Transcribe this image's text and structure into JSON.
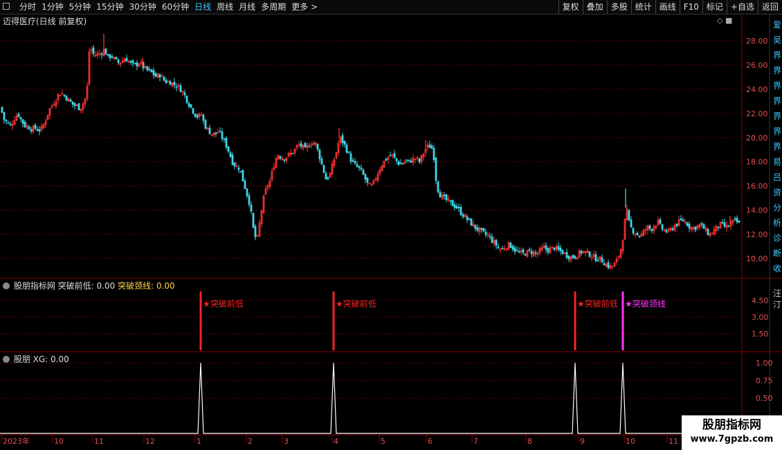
{
  "toolbar": {
    "tabs": [
      "分时",
      "1分钟",
      "5分钟",
      "15分钟",
      "30分钟",
      "60分钟",
      "日线",
      "周线",
      "月线",
      "多周期",
      "更多 >"
    ],
    "active_index": 6,
    "right_tools": [
      "复权",
      "叠加",
      "多股",
      "统计",
      "画线",
      "F10",
      "标记",
      "+自选",
      "返回"
    ]
  },
  "main": {
    "title": "迈得医疗(日线 前复权)",
    "right_side_chars": "爱吴界界界界界界界易吕资分析诊断收",
    "icons": "◇ ■"
  },
  "indicator1": {
    "name": "股朋指标网",
    "s1_label": "突破前低:",
    "s1_value": "0.00",
    "s2_label": "突破颈线:",
    "s2_value": "0.00",
    "right_chars": "汪汀"
  },
  "indicator2": {
    "name": "股朋",
    "xg_label": "XG:",
    "xg_value": "0.00"
  },
  "watermark": {
    "line1": "股朋指标网",
    "line2": "www.7gpzb.com"
  },
  "colors": {
    "up": "#ff3333",
    "down": "#43d6e6",
    "signal_low": "#ff2222",
    "signal_neck": "#ff33ff",
    "grid": "#6b0000",
    "active_tab": "#3cc8ff"
  },
  "chart_data": [
    {
      "type": "candlestick",
      "title": "迈得医疗(日线 前复权)",
      "y_ticks": [
        10.0,
        12.0,
        14.0,
        16.0,
        18.0,
        20.0,
        22.0,
        24.0,
        26.0,
        28.0
      ],
      "ylim": [
        8.6,
        29.2
      ],
      "x_labels": [
        "2023年",
        "10",
        "11",
        "12",
        "1",
        "2",
        "3",
        "4",
        "5",
        "6",
        "7",
        "8",
        "9",
        "10",
        "11"
      ],
      "close_path": [
        [
          0,
          22.5
        ],
        [
          5,
          21.5
        ],
        [
          10,
          21.2
        ],
        [
          15,
          21.0
        ],
        [
          20,
          21.6
        ],
        [
          25,
          22.0
        ],
        [
          30,
          21.4
        ],
        [
          35,
          21.0
        ],
        [
          40,
          20.9
        ],
        [
          45,
          20.7
        ],
        [
          50,
          20.8
        ],
        [
          55,
          20.6
        ],
        [
          60,
          20.8
        ],
        [
          63,
          21.2
        ],
        [
          67,
          21.8
        ],
        [
          70,
          22.3
        ],
        [
          75,
          22.7
        ],
        [
          80,
          23.2
        ],
        [
          83,
          23.5
        ],
        [
          87,
          23.7
        ],
        [
          90,
          23.6
        ],
        [
          95,
          23.3
        ],
        [
          100,
          23.0
        ],
        [
          105,
          22.7
        ],
        [
          110,
          22.6
        ],
        [
          115,
          22.4
        ],
        [
          118,
          22.7
        ],
        [
          122,
          23.2
        ],
        [
          125,
          24.2
        ],
        [
          127,
          27.0
        ],
        [
          130,
          27.4
        ],
        [
          135,
          26.8
        ],
        [
          140,
          26.9
        ],
        [
          145,
          27.0
        ],
        [
          150,
          27.3
        ],
        [
          155,
          26.6
        ],
        [
          160,
          26.8
        ],
        [
          165,
          26.4
        ],
        [
          170,
          26.2
        ],
        [
          175,
          26.3
        ],
        [
          180,
          26.6
        ],
        [
          185,
          26.3
        ],
        [
          190,
          26.0
        ],
        [
          195,
          26.0
        ],
        [
          200,
          26.2
        ],
        [
          205,
          25.9
        ],
        [
          210,
          25.6
        ],
        [
          215,
          25.5
        ],
        [
          220,
          25.3
        ],
        [
          225,
          25.0
        ],
        [
          230,
          25.2
        ],
        [
          235,
          24.8
        ],
        [
          240,
          24.6
        ],
        [
          245,
          24.6
        ],
        [
          250,
          24.4
        ],
        [
          255,
          24.3
        ],
        [
          260,
          24.0
        ],
        [
          265,
          23.6
        ],
        [
          270,
          23.0
        ],
        [
          275,
          22.5
        ],
        [
          280,
          22.0
        ],
        [
          285,
          21.7
        ],
        [
          290,
          21.9
        ],
        [
          295,
          21.0
        ],
        [
          300,
          20.6
        ],
        [
          305,
          20.3
        ],
        [
          310,
          20.3
        ],
        [
          315,
          20.5
        ],
        [
          320,
          20.0
        ],
        [
          325,
          19.5
        ],
        [
          330,
          18.8
        ],
        [
          335,
          18.0
        ],
        [
          340,
          17.6
        ],
        [
          345,
          17.5
        ],
        [
          350,
          16.5
        ],
        [
          355,
          15.5
        ],
        [
          360,
          14.5
        ],
        [
          365,
          12.5
        ],
        [
          370,
          11.3
        ],
        [
          373,
          12.5
        ],
        [
          377,
          14.0
        ],
        [
          381,
          15.3
        ],
        [
          385,
          16.0
        ],
        [
          389,
          16.4
        ],
        [
          393,
          17.3
        ],
        [
          397,
          18.2
        ],
        [
          401,
          18.6
        ],
        [
          405,
          18.4
        ],
        [
          410,
          18.3
        ],
        [
          415,
          18.5
        ],
        [
          420,
          18.7
        ],
        [
          425,
          19.0
        ],
        [
          430,
          19.4
        ],
        [
          435,
          19.3
        ],
        [
          440,
          19.0
        ],
        [
          445,
          19.4
        ],
        [
          450,
          19.6
        ],
        [
          455,
          19.5
        ],
        [
          460,
          18.6
        ],
        [
          465,
          17.6
        ],
        [
          470,
          16.6
        ],
        [
          475,
          16.8
        ],
        [
          480,
          17.8
        ],
        [
          485,
          18.8
        ],
        [
          490,
          20.0
        ],
        [
          495,
          19.6
        ],
        [
          500,
          19.0
        ],
        [
          505,
          18.3
        ],
        [
          510,
          17.8
        ],
        [
          515,
          17.6
        ],
        [
          520,
          17.3
        ],
        [
          525,
          16.8
        ],
        [
          530,
          16.2
        ],
        [
          535,
          15.9
        ],
        [
          540,
          16.4
        ],
        [
          545,
          17.1
        ],
        [
          550,
          17.7
        ],
        [
          555,
          18.1
        ],
        [
          560,
          18.4
        ],
        [
          565,
          18.6
        ],
        [
          570,
          18.2
        ],
        [
          575,
          17.9
        ],
        [
          580,
          17.8
        ],
        [
          585,
          18.1
        ],
        [
          590,
          18.0
        ],
        [
          595,
          18.2
        ],
        [
          600,
          18.3
        ],
        [
          605,
          18.0
        ],
        [
          610,
          18.6
        ],
        [
          615,
          19.2
        ],
        [
          620,
          19.3
        ],
        [
          625,
          19.0
        ],
        [
          630,
          16.0
        ],
        [
          635,
          15.3
        ],
        [
          640,
          15.0
        ],
        [
          645,
          14.8
        ],
        [
          650,
          14.6
        ],
        [
          655,
          14.4
        ],
        [
          660,
          14.2
        ],
        [
          665,
          13.8
        ],
        [
          670,
          13.5
        ],
        [
          675,
          13.2
        ],
        [
          680,
          12.9
        ],
        [
          685,
          12.6
        ],
        [
          690,
          12.4
        ],
        [
          695,
          12.2
        ],
        [
          700,
          12.0
        ],
        [
          705,
          11.9
        ],
        [
          710,
          11.5
        ],
        [
          715,
          11.2
        ],
        [
          720,
          10.8
        ],
        [
          725,
          10.8
        ],
        [
          730,
          11.0
        ],
        [
          735,
          11.2
        ],
        [
          740,
          10.9
        ],
        [
          745,
          10.6
        ],
        [
          750,
          10.5
        ],
        [
          755,
          10.4
        ],
        [
          760,
          10.5
        ],
        [
          765,
          10.6
        ],
        [
          770,
          10.5
        ],
        [
          775,
          10.4
        ],
        [
          780,
          10.7
        ],
        [
          785,
          10.9
        ],
        [
          790,
          10.7
        ],
        [
          795,
          10.8
        ],
        [
          800,
          10.9
        ],
        [
          805,
          10.7
        ],
        [
          810,
          10.6
        ],
        [
          815,
          10.4
        ],
        [
          820,
          10.2
        ],
        [
          825,
          10.1
        ],
        [
          830,
          10.2
        ],
        [
          835,
          10.4
        ],
        [
          840,
          10.6
        ],
        [
          845,
          10.5
        ],
        [
          850,
          10.4
        ],
        [
          855,
          10.2
        ],
        [
          860,
          10.0
        ],
        [
          865,
          10.0
        ],
        [
          870,
          9.8
        ],
        [
          875,
          9.5
        ],
        [
          880,
          9.3
        ],
        [
          885,
          9.4
        ],
        [
          890,
          9.8
        ],
        [
          895,
          10.5
        ],
        [
          900,
          12.0
        ],
        [
          904,
          14.2
        ],
        [
          908,
          13.0
        ],
        [
          912,
          12.4
        ],
        [
          916,
          12.2
        ],
        [
          920,
          12.0
        ],
        [
          925,
          11.9
        ],
        [
          930,
          12.3
        ],
        [
          935,
          12.6
        ],
        [
          940,
          12.4
        ],
        [
          945,
          12.8
        ],
        [
          950,
          13.0
        ],
        [
          955,
          12.5
        ],
        [
          960,
          12.3
        ],
        [
          965,
          12.2
        ],
        [
          970,
          12.5
        ],
        [
          975,
          12.8
        ],
        [
          980,
          13.0
        ],
        [
          985,
          13.2
        ],
        [
          990,
          13.0
        ],
        [
          995,
          12.7
        ],
        [
          1000,
          12.5
        ],
        [
          1005,
          12.6
        ],
        [
          1010,
          12.8
        ],
        [
          1015,
          12.6
        ],
        [
          1020,
          12.2
        ],
        [
          1025,
          12.0
        ],
        [
          1030,
          12.3
        ],
        [
          1035,
          12.6
        ],
        [
          1040,
          12.8
        ],
        [
          1045,
          12.7
        ],
        [
          1050,
          12.6
        ],
        [
          1055,
          12.9
        ],
        [
          1060,
          13.1
        ],
        [
          1065,
          13.0
        ],
        [
          1068,
          12.8
        ]
      ],
      "spikes": [
        [
          150,
          28.6
        ],
        [
          206,
          26.6
        ],
        [
          490,
          20.8
        ],
        [
          615,
          19.8
        ],
        [
          904,
          15.8
        ],
        [
          1055,
          13.5
        ]
      ]
    },
    {
      "type": "signal",
      "y_ticks": [
        1.5,
        3.0,
        4.5
      ],
      "ylim": [
        0,
        5.5
      ],
      "signals": [
        {
          "x": 290,
          "label": "★突破前低",
          "kind": "low"
        },
        {
          "x": 482,
          "label": "★突破前低",
          "kind": "low"
        },
        {
          "x": 831,
          "label": "★突破前低",
          "kind": "low"
        },
        {
          "x": 900,
          "label": "★突破颈线",
          "kind": "neck"
        }
      ]
    },
    {
      "type": "line",
      "series": [
        {
          "name": "XG",
          "spikes_at": [
            290,
            482,
            831,
            900
          ],
          "value": 1
        }
      ],
      "y_ticks": [
        0.5,
        0.75,
        1.0
      ],
      "ylim": [
        0,
        1.1
      ]
    }
  ]
}
